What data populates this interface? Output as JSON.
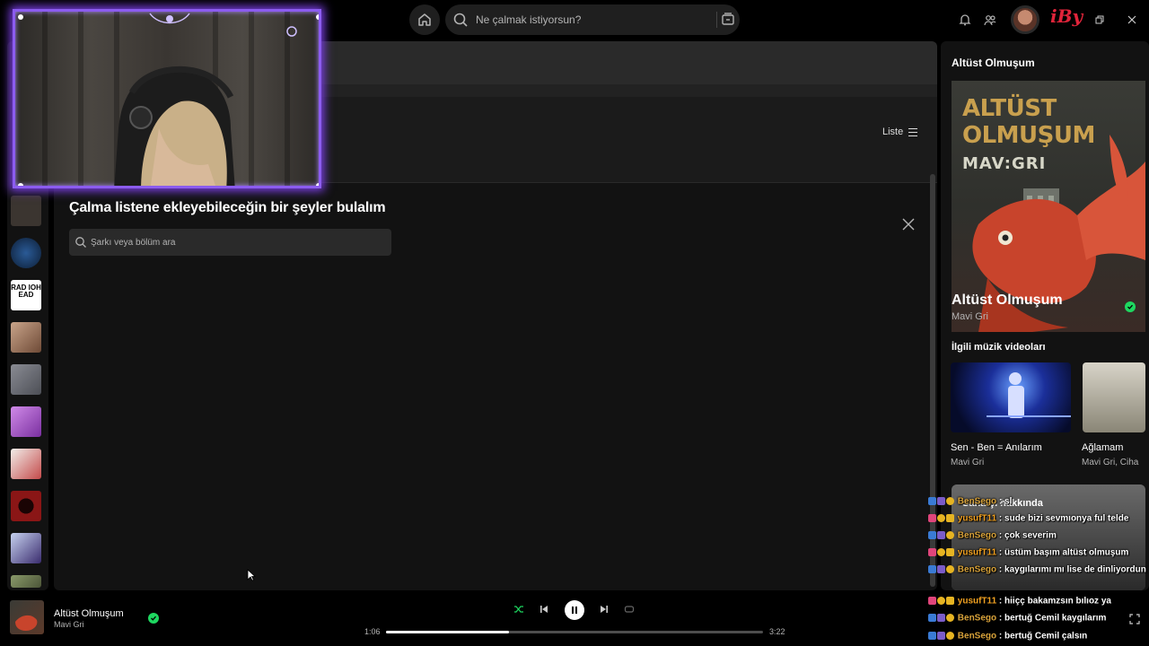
{
  "topbar": {
    "search_placeholder": "Ne çalmak istiyorsun?",
    "home_icon": "home-icon",
    "search_icon": "search-icon",
    "browse_icon": "browse-icon",
    "bell_icon": "bell-icon",
    "friends_icon": "friends-icon",
    "logo_text": "iBy"
  },
  "main": {
    "view_toggle_label": "Liste",
    "find_title": "Çalma listene ekleyebileceğin bir şeyler bulalım",
    "find_search_placeholder": "Şarkı veya bölüm ara"
  },
  "library": {
    "items": [
      {
        "name": "library-item-1",
        "color": "#3b3530"
      },
      {
        "name": "library-item-2",
        "color": "#1d3c66"
      },
      {
        "name": "library-item-radiohead",
        "color": "#ffffff",
        "text": "RAD IOH EAD"
      },
      {
        "name": "library-item-4",
        "color": "#b08a70"
      },
      {
        "name": "library-item-5",
        "color": "#6d7078"
      },
      {
        "name": "library-item-6",
        "color": "#b06bd0"
      },
      {
        "name": "library-item-7",
        "color": "#e7e2de"
      },
      {
        "name": "library-item-8",
        "color": "#7a1414"
      },
      {
        "name": "library-item-9",
        "color": "#a8b6d8"
      },
      {
        "name": "library-item-10",
        "color": "#6b7a56"
      }
    ]
  },
  "right_panel": {
    "header_title": "Altüst Olmuşum",
    "cover_line1": "ALTÜST",
    "cover_line2": "OLMUŞUM",
    "cover_brand": "MAV:GRI",
    "song_title": "Altüst Olmuşum",
    "artist": "Mavi Gri",
    "related_videos_title": "İlgili müzik videoları",
    "videos": [
      {
        "title": "Sen - Ben = Anılarım",
        "artist": "Mavi Gri"
      },
      {
        "title": "Ağlamam",
        "artist": "Mavi Gri, Ciha"
      }
    ],
    "about_title": "Sanatçı hakkında"
  },
  "player": {
    "track_title": "Altüst Olmuşum",
    "track_artist": "Mavi Gri",
    "elapsed": "1:06",
    "duration": "3:22",
    "progress": 0.327
  },
  "chat": {
    "lines": [
      {
        "user": "BenSego",
        "sep": " : ",
        "msg": "sl"
      },
      {
        "user": "yusufT11",
        "sep": " : ",
        "msg": "sude bizi sevmıonya ful telde"
      },
      {
        "user": "BenSego",
        "sep": " : ",
        "msg": "çok severim"
      },
      {
        "user": "yusufT11",
        "sep": " : ",
        "msg": "üstüm başım altüst olmuşum"
      },
      {
        "user": "BenSego",
        "sep": " : ",
        "msg": "kaygılarımı mı lise de dinliyordun"
      },
      {
        "user": "yusufT11",
        "sep": " : ",
        "msg": "hiiçç bakamzsın bılıoz ya"
      },
      {
        "user": "BenSego",
        "sep": " : ",
        "msg": "bertuğ Cemil kaygılarım"
      },
      {
        "user": "BenSego",
        "sep": " : ",
        "msg": "bertuğ Cemil çalsın"
      }
    ]
  },
  "colors": {
    "accent_green": "#1ed760",
    "webcam_border": "#8c5cf0",
    "chat_user": "#d9a33a"
  }
}
